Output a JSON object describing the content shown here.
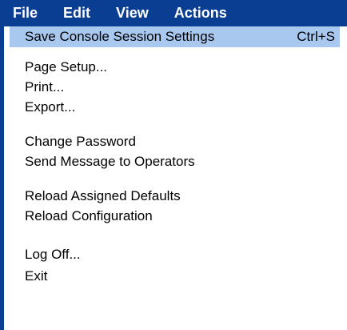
{
  "menubar": {
    "items": [
      {
        "label": "File"
      },
      {
        "label": "Edit"
      },
      {
        "label": "View"
      },
      {
        "label": "Actions"
      }
    ]
  },
  "file_menu": {
    "items": [
      {
        "label": "Save Console Session Settings",
        "shortcut": "Ctrl+S"
      },
      {
        "label": "Page Setup..."
      },
      {
        "label": "Print..."
      },
      {
        "label": "Export..."
      },
      {
        "label": "Change Password"
      },
      {
        "label": "Send Message to Operators"
      },
      {
        "label": "Reload Assigned Defaults"
      },
      {
        "label": "Reload Configuration"
      },
      {
        "label": "Log Off..."
      },
      {
        "label": "Exit"
      }
    ]
  },
  "colors": {
    "menubar_bg": "#0a3e93",
    "highlight_bg": "#a8c8f0",
    "menu_bg": "#ffffff",
    "text": "#000000"
  }
}
